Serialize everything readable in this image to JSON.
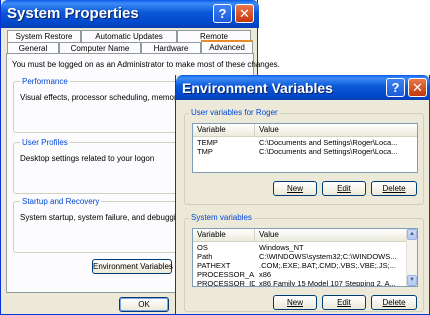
{
  "system_properties": {
    "title": "System Properties",
    "help_glyph": "?",
    "close_glyph": "✕",
    "tabs_row1": [
      "System Restore",
      "Automatic Updates",
      "Remote"
    ],
    "tabs_row2": [
      "General",
      "Computer Name",
      "Hardware",
      "Advanced"
    ],
    "active_tab": "Advanced",
    "admin_note": "You must be logged on as an Administrator to make most of these changes.",
    "performance": {
      "title": "Performance",
      "desc": "Visual effects, processor scheduling, memory usag"
    },
    "user_profiles": {
      "title": "User Profiles",
      "desc": "Desktop settings related to your logon"
    },
    "startup_recovery": {
      "title": "Startup and Recovery",
      "desc": "System startup, system failure, and debugging infor"
    },
    "env_button": "Environment Variables",
    "ok_button": "OK"
  },
  "environment_variables": {
    "title": "Environment Variables",
    "help_glyph": "?",
    "close_glyph": "✕",
    "user_group_title": "User variables for Roger",
    "user_columns": [
      "Variable",
      "Value"
    ],
    "user_rows": [
      {
        "variable": "TEMP",
        "value": "C:\\Documents and Settings\\Roger\\Loca..."
      },
      {
        "variable": "TMP",
        "value": "C:\\Documents and Settings\\Roger\\Loca..."
      }
    ],
    "user_buttons": {
      "new": "New",
      "edit": "Edit",
      "delete": "Delete"
    },
    "system_group_title": "System variables",
    "system_columns": [
      "Variable",
      "Value"
    ],
    "system_rows": [
      {
        "variable": "OS",
        "value": "Windows_NT"
      },
      {
        "variable": "Path",
        "value": "C:\\WINDOWS\\system32;C:\\WINDOWS..."
      },
      {
        "variable": "PATHEXT",
        "value": ".COM;.EXE;.BAT;.CMD;.VBS;.VBE;.JS;..."
      },
      {
        "variable": "PROCESSOR_A...",
        "value": "x86"
      },
      {
        "variable": "PROCESSOR_ID...",
        "value": "x86 Family 15 Model 107 Stepping 2, A..."
      }
    ],
    "system_buttons": {
      "new": "New",
      "edit": "Edit",
      "delete": "Delete"
    },
    "scroll_up": "▲",
    "scroll_down": "▼"
  }
}
